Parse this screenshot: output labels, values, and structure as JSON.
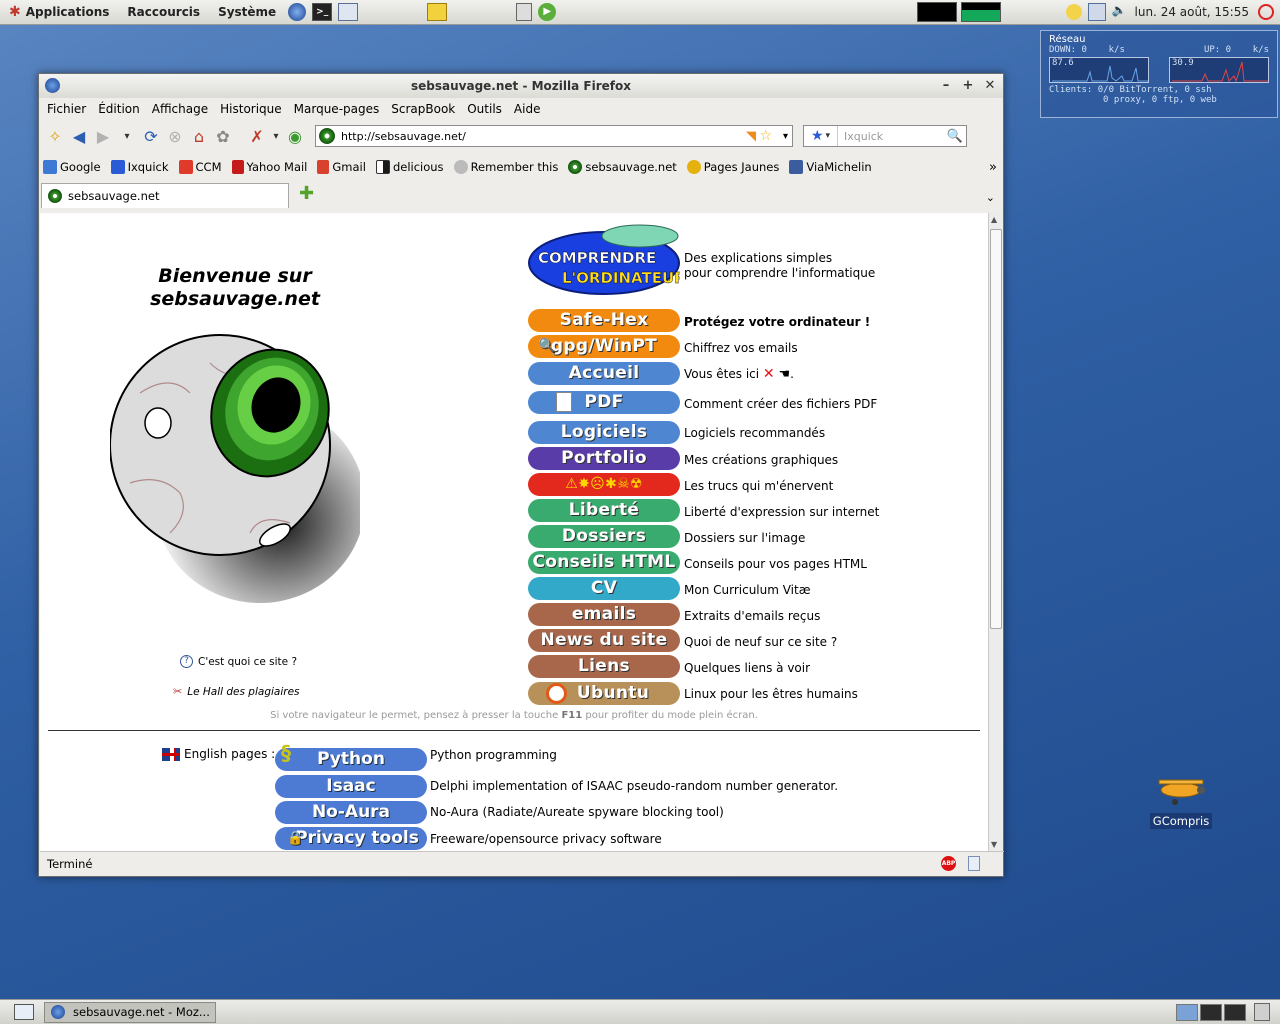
{
  "top_panel": {
    "menus": [
      "Applications",
      "Raccourcis",
      "Système"
    ],
    "clock": "lun. 24 août, 15:55"
  },
  "net_widget": {
    "title": "Réseau",
    "down_label": "DOWN:",
    "down_value": "0",
    "down_unit": "k/s",
    "up_label": "UP:",
    "up_value": "0",
    "up_unit": "k/s",
    "down_peak": "87.6",
    "up_peak": "30.9",
    "clients_line1": "Clients: 0/0 BitTorrent, 0 ssh",
    "clients_line2": "0 proxy, 0 ftp, 0 web"
  },
  "window": {
    "title": "sebsauvage.net - Mozilla Firefox",
    "menu": [
      "Fichier",
      "Édition",
      "Affichage",
      "Historique",
      "Marque-pages",
      "ScrapBook",
      "Outils",
      "Aide"
    ],
    "url": "http://sebsauvage.net/",
    "search_placeholder": "Ixquick",
    "bookmarks": [
      "Google",
      "Ixquick",
      "CCM",
      "Yahoo Mail",
      "Gmail",
      "delicious",
      "Remember this",
      "sebsauvage.net",
      "Pages Jaunes",
      "ViaMichelin"
    ],
    "bookmark_colors": [
      "#3d7ad6",
      "#2a5bd7",
      "#e03a2a",
      "#c41a1a",
      "#d9412f",
      "#1a1a1a",
      "#7a7a7a",
      "#3c9a2e",
      "#e5b20d",
      "#3b5d9e"
    ],
    "tab_title": "sebsauvage.net",
    "status": "Terminé"
  },
  "page": {
    "welcome_line1": "Bienvenue sur",
    "welcome_line2": "sebsauvage.net",
    "what_is_site": "C'est quoi ce site ?",
    "hall": "Le Hall des plagiaires",
    "comprendre_logo_l1": "COMPRENDRE",
    "comprendre_logo_l2": "L'ORDINATEUR",
    "comprendre_desc1": "Des explications simples",
    "comprendre_desc2": "pour comprendre l'informatique",
    "menu": [
      {
        "label": "Safe-Hex",
        "desc": "Protégez votre ordinateur !",
        "color": "#f28a10",
        "bold": true
      },
      {
        "label": "gpg/WinPT",
        "desc": "Chiffrez vos emails",
        "color": "#f28a10"
      },
      {
        "label": "Accueil",
        "desc": "Vous êtes ici",
        "color": "#4e86d2"
      },
      {
        "label": "PDF",
        "desc": "Comment créer des fichiers PDF",
        "color": "#4e86d2"
      },
      {
        "label": "Logiciels",
        "desc": "Logiciels recommandés",
        "color": "#4e86d2"
      },
      {
        "label": "Portfolio",
        "desc": "Mes créations graphiques",
        "color": "#5a3ca8"
      },
      {
        "label": "",
        "desc": "Les trucs qui m'énervent",
        "color": "#e3281d"
      },
      {
        "label": "Liberté",
        "desc": "Liberté d'expression sur internet",
        "color": "#3aab6f"
      },
      {
        "label": "Dossiers",
        "desc": "Dossiers sur l'image",
        "color": "#3aab6f"
      },
      {
        "label": "Conseils HTML",
        "desc": "Conseils pour vos pages HTML",
        "color": "#3aab6f"
      },
      {
        "label": "CV",
        "desc": "Mon Curriculum Vitæ",
        "color": "#32a9c8"
      },
      {
        "label": "emails",
        "desc": "Extraits d'emails reçus",
        "color": "#a8674a"
      },
      {
        "label": "News du site",
        "desc": "Quoi de neuf sur ce site ?",
        "color": "#a8674a"
      },
      {
        "label": "Liens",
        "desc": "Quelques liens à voir",
        "color": "#a8674a"
      },
      {
        "label": "Ubuntu",
        "desc": "Linux pour les êtres humains",
        "color": "#b8915a"
      }
    ],
    "note_pre": "Si votre navigateur le permet, pensez à presser la touche",
    "note_key": "F11",
    "note_post": "pour profiter du mode plein écran.",
    "english_label": "English pages :",
    "english": [
      {
        "label": "Python",
        "desc": "Python programming"
      },
      {
        "label": "Isaac",
        "desc": "Delphi implementation of ISAAC pseudo-random number generator."
      },
      {
        "label": "No-Aura",
        "desc": "No-Aura (Radiate/Aureate spyware blocking tool)"
      },
      {
        "label": "Privacy tools",
        "desc": "Freeware/opensource privacy software"
      }
    ]
  },
  "desktop": {
    "icon_label": "GCompris"
  },
  "taskbar": {
    "task_label": "sebsauvage.net - Moz..."
  }
}
